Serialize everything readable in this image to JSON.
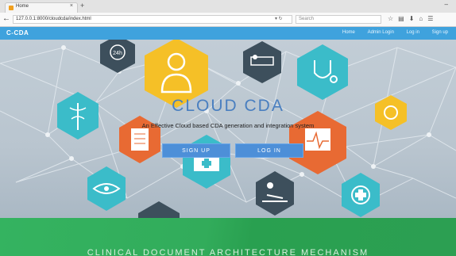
{
  "browser": {
    "tab_title": "Home",
    "url": "127.0.0.1:8000/cloudcda/index.html",
    "search_placeholder": "Search",
    "new_tab": "+",
    "close_tab": "×",
    "back": "←",
    "window_control": "–"
  },
  "site": {
    "brand": "C-CDA",
    "nav": [
      "Home",
      "Admin Login",
      "Log in",
      "Sign up"
    ]
  },
  "hero": {
    "title": "CLOUD CDA",
    "subtitle": "An Effective Cloud based CDA generation and integration system",
    "signup_label": "SIGN UP",
    "login_label": "LOG IN",
    "clock_label": "24h"
  },
  "banner": {
    "title": "CLINICAL DOCUMENT ARCHITECTURE MECHANISM"
  },
  "colors": {
    "nav_bar": "#3fa2dd",
    "title": "#4a7fc0",
    "button": "#4d8fd8",
    "banner": "#32ac5b",
    "hex_yellow": "#f5c027",
    "hex_dark": "#3d4f5c",
    "hex_teal": "#3bbcc9",
    "hex_orange": "#e86a33"
  }
}
